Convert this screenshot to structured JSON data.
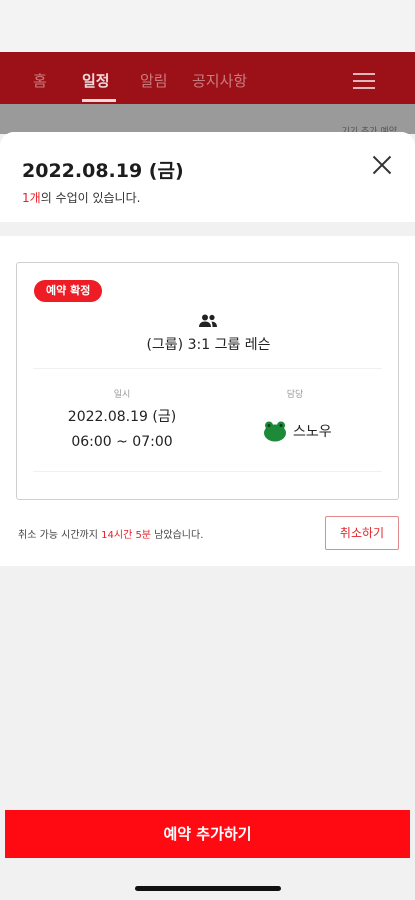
{
  "nav": {
    "items": [
      "홈",
      "일정",
      "알림",
      "공지사항"
    ],
    "active": "일정"
  },
  "background": {
    "partial_text": "기기 추가 예약"
  },
  "sheet": {
    "date_title": "2022.08.19 (금)",
    "count_highlight": "1개",
    "count_suffix": "의 수업이 있습니다."
  },
  "card": {
    "status_badge": "예약 확정",
    "class_name": "(그룹) 3:1 그룹 레슨",
    "label_datetime": "일시",
    "label_instructor": "담당",
    "date": "2022.08.19 (금)",
    "time": "06:00 ~ 07:00",
    "instructor": "스노우"
  },
  "cancel": {
    "note_prefix": "취소 가능 시간까지 ",
    "note_highlight": "14시간 5분",
    "note_suffix": " 남았습니다.",
    "button": "취소하기"
  },
  "footer": {
    "add_button": "예약 추가하기"
  },
  "colors": {
    "brand_red": "#ff0a12",
    "nav_bg": "#9c1017",
    "highlight": "#e8202a"
  }
}
